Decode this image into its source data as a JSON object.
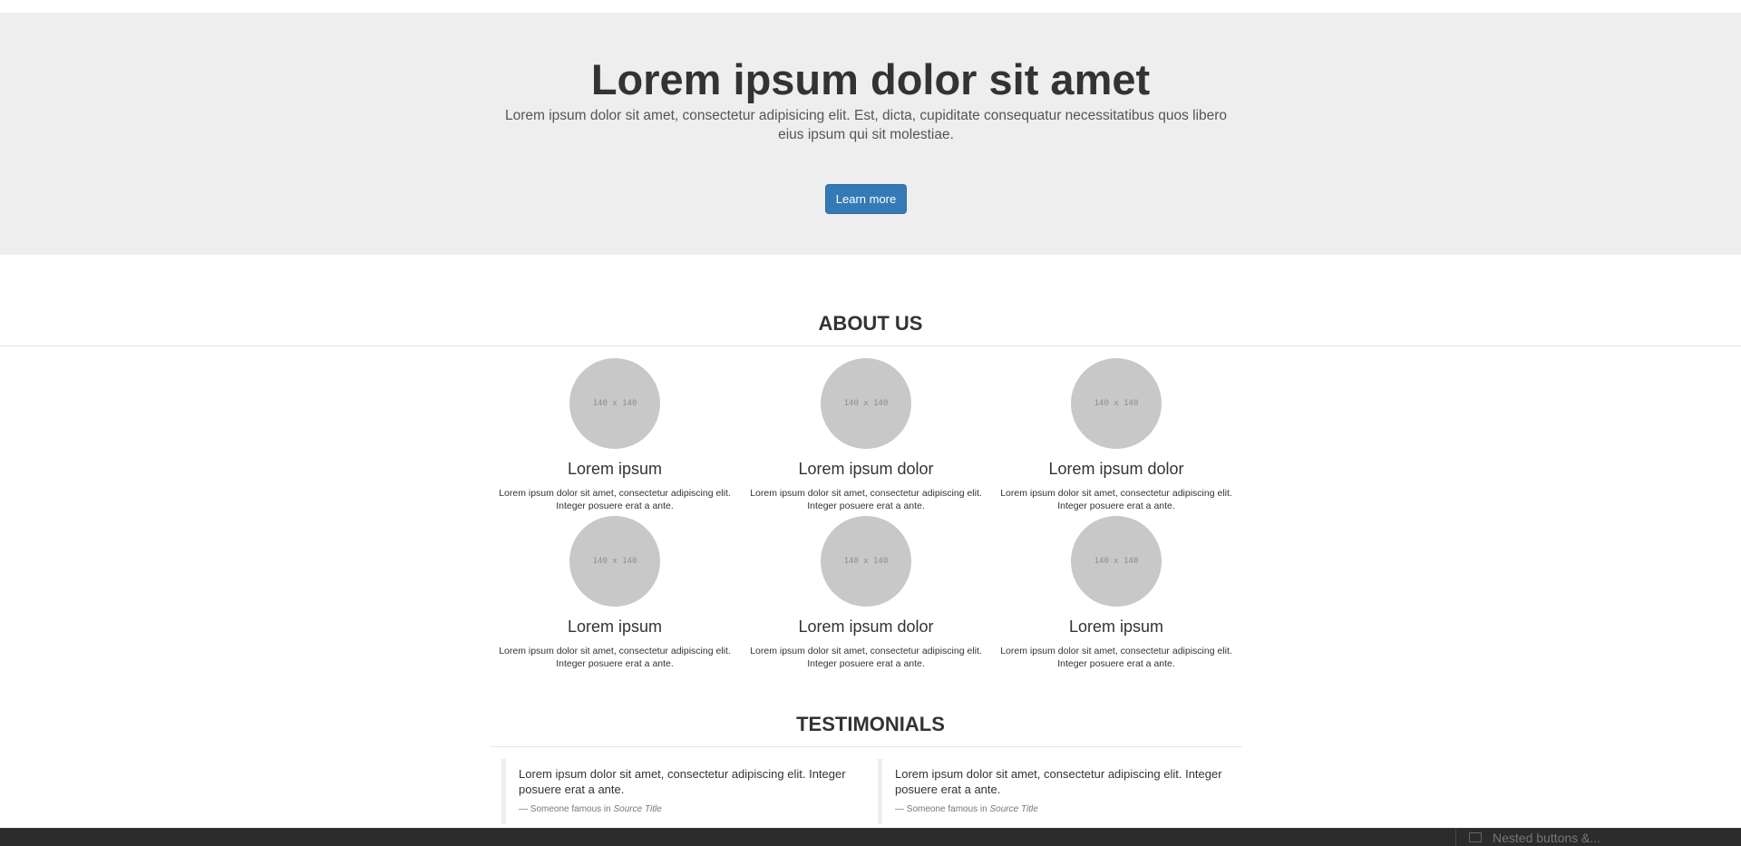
{
  "jumbotron": {
    "title": "Lorem ipsum dolor sit amet",
    "lead": "Lorem ipsum dolor sit amet, consectetur adipisicing elit. Est, dicta, cupiditate consequatur necessitatibus quos libero eius ipsum qui sit molestiae.",
    "button_label": "Learn more"
  },
  "about": {
    "title": "ABOUT US",
    "features": [
      {
        "placeholder": "140 x 140",
        "heading": "Lorem ipsum",
        "text": "Lorem ipsum dolor sit amet, consectetur adipiscing elit. Integer posuere erat a ante."
      },
      {
        "placeholder": "140 x 140",
        "heading": "Lorem ipsum dolor",
        "text": "Lorem ipsum dolor sit amet, consectetur adipiscing elit. Integer posuere erat a ante."
      },
      {
        "placeholder": "140 x 140",
        "heading": "Lorem ipsum dolor",
        "text": "Lorem ipsum dolor sit amet, consectetur adipiscing elit. Integer posuere erat a ante."
      },
      {
        "placeholder": "140 x 140",
        "heading": "Lorem ipsum",
        "text": "Lorem ipsum dolor sit amet, consectetur adipiscing elit. Integer posuere erat a ante."
      },
      {
        "placeholder": "140 x 140",
        "heading": "Lorem ipsum dolor",
        "text": "Lorem ipsum dolor sit amet, consectetur adipiscing elit. Integer posuere erat a ante."
      },
      {
        "placeholder": "140 x 140",
        "heading": "Lorem ipsum",
        "text": "Lorem ipsum dolor sit amet, consectetur adipiscing elit. Integer posuere erat a ante."
      }
    ]
  },
  "testimonials": {
    "title": "TESTIMONIALS",
    "quotes": [
      {
        "text": "Lorem ipsum dolor sit amet, consectetur adipiscing elit. Integer posuere erat a ante.",
        "author": "— Someone famous in ",
        "source": "Source Title"
      },
      {
        "text": "Lorem ipsum dolor sit amet, consectetur adipiscing elit. Integer posuere erat a ante.",
        "author": "— Someone famous in ",
        "source": "Source Title"
      }
    ]
  },
  "taskbar": {
    "item_label": "Nested buttons &..."
  },
  "colors": {
    "jumbotron_bg": "#eeeeee",
    "primary": "#337ab7",
    "placeholder_circle": "#c8c8c8",
    "taskbar_bg": "#2b2b2b"
  }
}
